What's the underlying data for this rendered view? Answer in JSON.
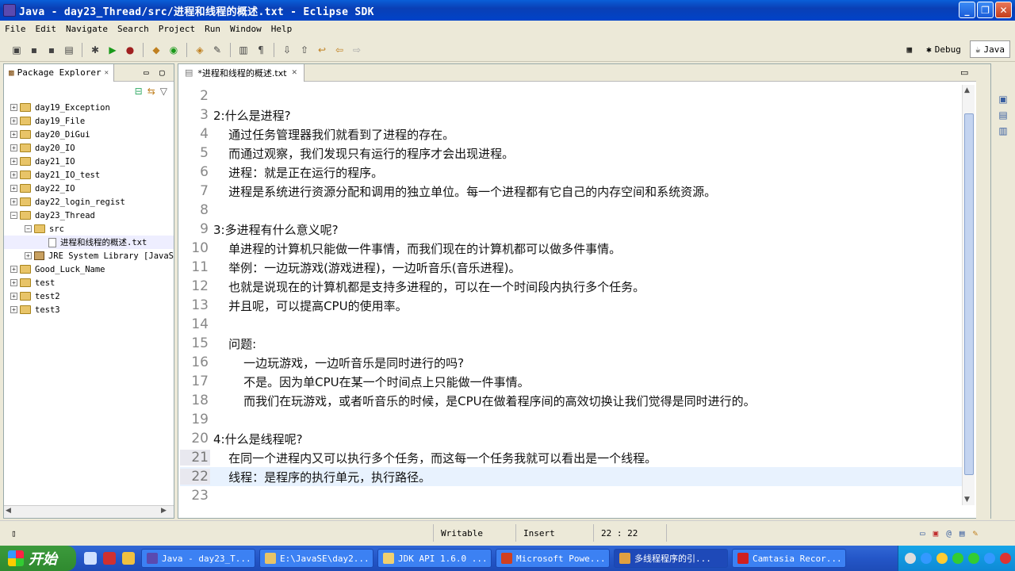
{
  "window": {
    "title": "Java - day23_Thread/src/进程和线程的概述.txt - Eclipse SDK",
    "minimize": "_",
    "maximize": "❐",
    "close": "✕"
  },
  "menu": [
    "File",
    "Edit",
    "Navigate",
    "Search",
    "Project",
    "Run",
    "Window",
    "Help"
  ],
  "perspectives": {
    "debug": "Debug",
    "java": "Java"
  },
  "package_explorer": {
    "tab_label": "Package Explorer",
    "tab_close": "✕",
    "items": [
      {
        "label": "day19_Exception",
        "expander": "+"
      },
      {
        "label": "day19_File",
        "expander": "+"
      },
      {
        "label": "day20_DiGui",
        "expander": "+"
      },
      {
        "label": "day20_IO",
        "expander": "+"
      },
      {
        "label": "day21_IO",
        "expander": "+"
      },
      {
        "label": "day21_IO_test",
        "expander": "+"
      },
      {
        "label": "day22_IO",
        "expander": "+"
      },
      {
        "label": "day22_login_regist",
        "expander": "+"
      },
      {
        "label": "day23_Thread",
        "expander": "−"
      },
      {
        "label": "src",
        "expander": "−"
      },
      {
        "label": "进程和线程的概述.txt",
        "expander": ""
      },
      {
        "label": "JRE System Library [JavaS",
        "expander": "+"
      },
      {
        "label": "Good_Luck_Name",
        "expander": "+"
      },
      {
        "label": "test",
        "expander": "+"
      },
      {
        "label": "test2",
        "expander": "+"
      },
      {
        "label": "test3",
        "expander": "+"
      }
    ]
  },
  "editor": {
    "tab_label": "*进程和线程的概述.txt",
    "tab_close": "✕",
    "lines": [
      {
        "n": "2",
        "text": ""
      },
      {
        "n": "3",
        "text": "2:什么是进程?"
      },
      {
        "n": "4",
        "text": "    通过任务管理器我们就看到了进程的存在。"
      },
      {
        "n": "5",
        "text": "    而通过观察，我们发现只有运行的程序才会出现进程。"
      },
      {
        "n": "6",
        "text": "    进程：就是正在运行的程序。"
      },
      {
        "n": "7",
        "text": "    进程是系统进行资源分配和调用的独立单位。每一个进程都有它自己的内存空间和系统资源。"
      },
      {
        "n": "8",
        "text": ""
      },
      {
        "n": "9",
        "text": "3:多进程有什么意义呢?"
      },
      {
        "n": "10",
        "text": "    单进程的计算机只能做一件事情，而我们现在的计算机都可以做多件事情。"
      },
      {
        "n": "11",
        "text": "    举例：一边玩游戏(游戏进程)，一边听音乐(音乐进程)。"
      },
      {
        "n": "12",
        "text": "    也就是说现在的计算机都是支持多进程的，可以在一个时间段内执行多个任务。"
      },
      {
        "n": "13",
        "text": "    并且呢，可以提高CPU的使用率。"
      },
      {
        "n": "14",
        "text": ""
      },
      {
        "n": "15",
        "text": "    问题:"
      },
      {
        "n": "16",
        "text": "        一边玩游戏，一边听音乐是同时进行的吗?"
      },
      {
        "n": "17",
        "text": "        不是。因为单CPU在某一个时间点上只能做一件事情。"
      },
      {
        "n": "18",
        "text": "        而我们在玩游戏，或者听音乐的时候，是CPU在做着程序间的高效切换让我们觉得是同时进行的。"
      },
      {
        "n": "19",
        "text": ""
      },
      {
        "n": "20",
        "text": "4:什么是线程呢?"
      },
      {
        "n": "21",
        "text": "    在同一个进程内又可以执行多个任务，而这每一个任务我就可以看出是一个线程。"
      },
      {
        "n": "22",
        "text": "    线程：是程序的执行单元，执行路径。"
      },
      {
        "n": "23",
        "text": ""
      }
    ]
  },
  "status": {
    "writable": "Writable",
    "insert": "Insert",
    "position": "22 : 22"
  },
  "taskbar": {
    "start": "开始",
    "tasks": [
      {
        "label": "Java - day23_T...",
        "color": "#5a4ab0"
      },
      {
        "label": "E:\\JavaSE\\day2...",
        "color": "#e8c468"
      },
      {
        "label": "JDK API 1.6.0 ...",
        "color": "#f0d070"
      },
      {
        "label": "Microsoft Powe...",
        "color": "#d04020"
      },
      {
        "label": "多线程程序的引...",
        "color": "#e0a040"
      },
      {
        "label": "Camtasia Recor...",
        "color": "#d02020"
      }
    ]
  }
}
